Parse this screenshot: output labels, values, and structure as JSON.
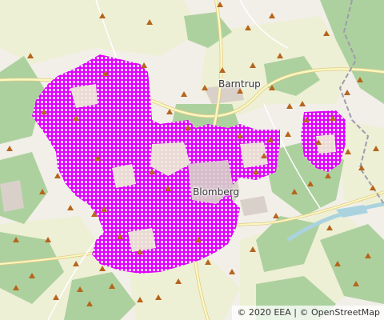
{
  "map": {
    "places": [
      {
        "id": "barntrup",
        "name": "Barntrup"
      },
      {
        "id": "blomberg",
        "name": "Blomberg"
      }
    ],
    "attribution": {
      "eea": "© 2020 EEA",
      "separator": "|",
      "osm": "© OpenStreetMap"
    },
    "colors": {
      "land": "#f2efe9",
      "farmland": "#eef0d5",
      "forest": "#add19e",
      "urban": "#d9d0c9",
      "water": "#aad3df",
      "road": "#f7fabf",
      "overlay_fill": "#e100ff",
      "overlay_cell": "#f5c6fa",
      "border": "#9e9cab",
      "peak": "#b5651d"
    },
    "icons": [
      "peak-icon"
    ]
  }
}
